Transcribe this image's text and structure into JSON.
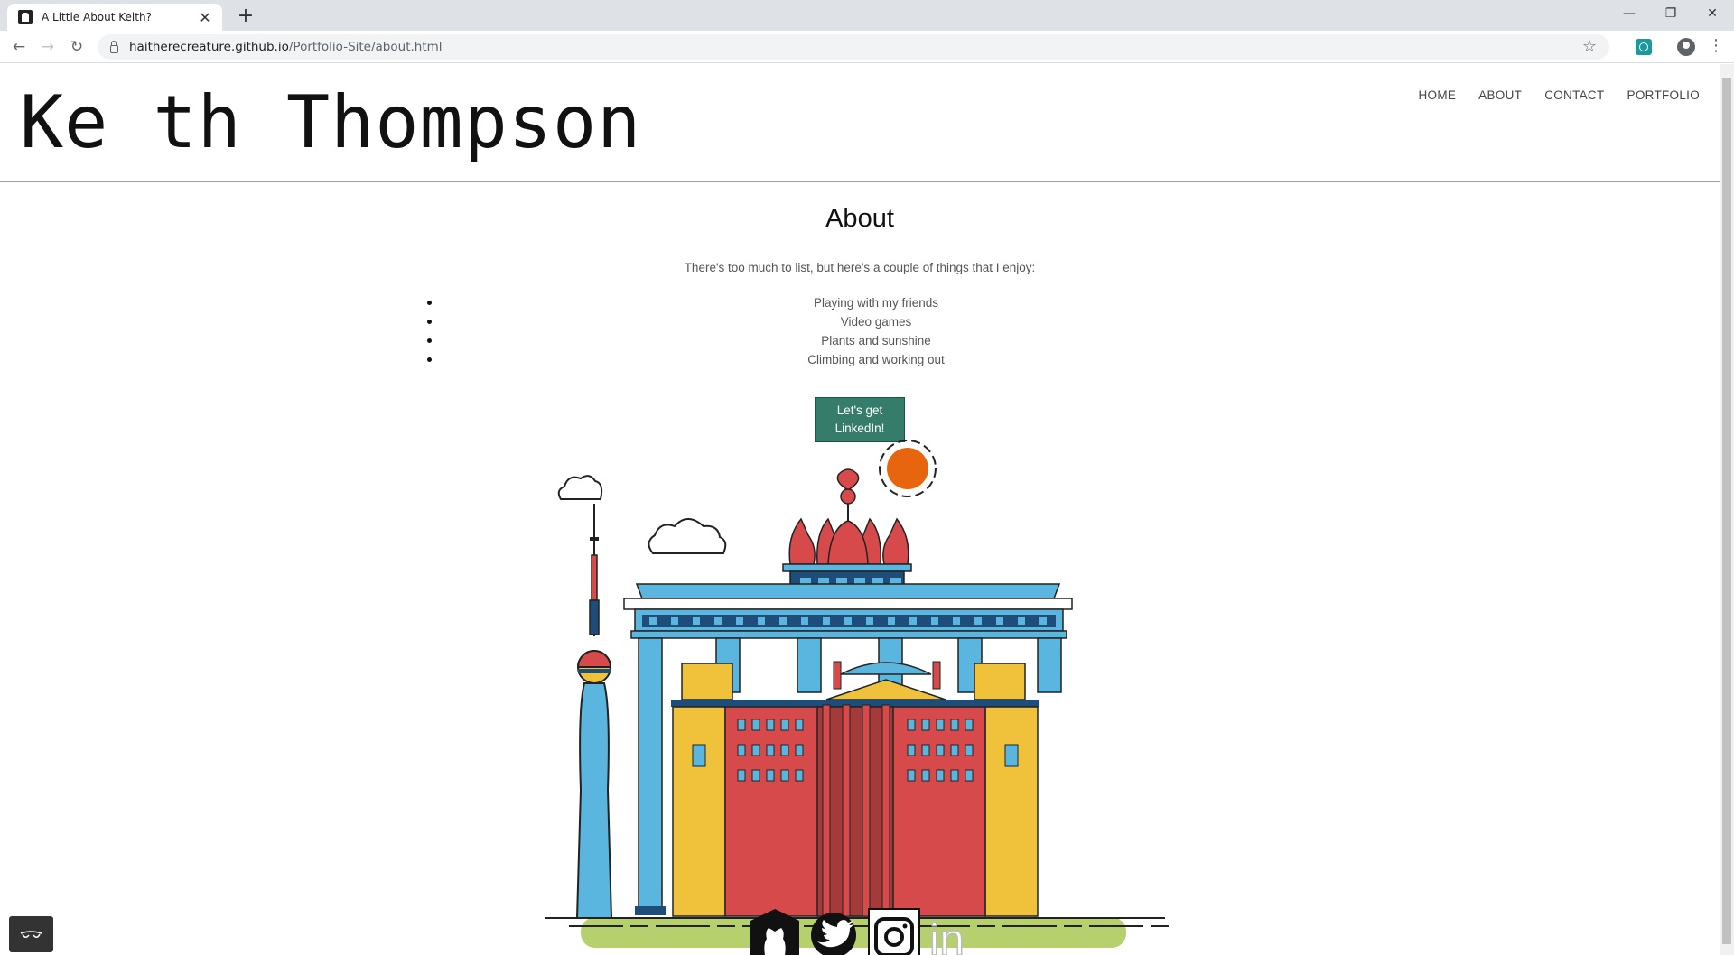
{
  "browser": {
    "tab_title": "A Little About Keith?",
    "new_tab_label": "+",
    "url_domain": "haitherecreature.github.io",
    "url_path": "/Portfolio-Site/about.html"
  },
  "site": {
    "logo": "Ke th Thompson",
    "nav": [
      "HOME",
      "ABOUT",
      "CONTACT",
      "PORTFOLIO"
    ]
  },
  "about": {
    "title": "About",
    "intro": "There's too much to list, but here's a couple of things that I enjoy:",
    "items": [
      "Playing with my friends",
      "Video games",
      "Plants and sunshine",
      "Climbing and working out"
    ],
    "button": "Let's get LinkedIn!"
  },
  "illustration": {
    "name": "Berlin landmarks",
    "colors": {
      "sun": "#e8650f",
      "blue": "#5ab6de",
      "navy": "#1f4d7a",
      "red": "#d64a4b",
      "yellow": "#f0c23b",
      "grass": "#b5d06c"
    }
  },
  "social": [
    "github-icon",
    "twitter-icon",
    "instagram-icon",
    "linkedin-icon"
  ],
  "social_letters": {
    "linkedin": "in"
  }
}
